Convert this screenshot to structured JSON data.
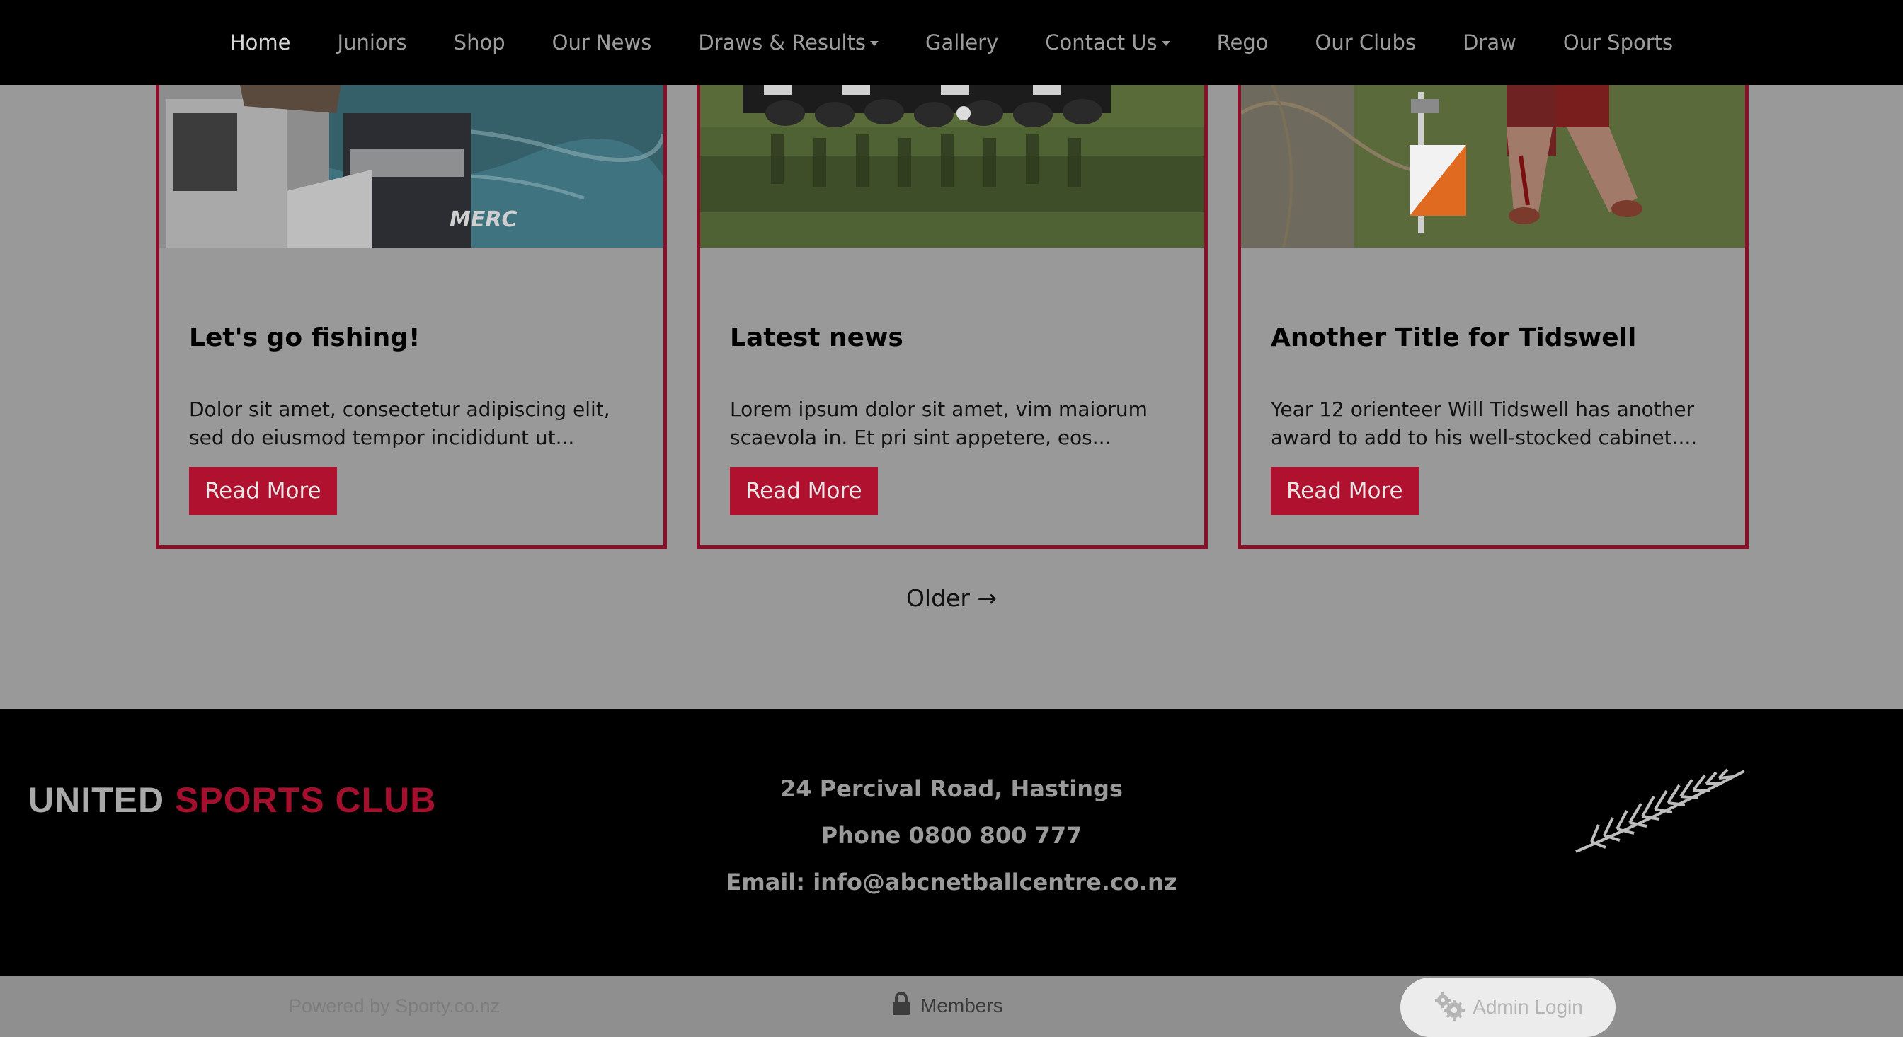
{
  "nav": {
    "items": [
      {
        "label": "Home"
      },
      {
        "label": "Juniors"
      },
      {
        "label": "Shop"
      },
      {
        "label": "Our News"
      },
      {
        "label": "Draws & Results"
      },
      {
        "label": "Gallery"
      },
      {
        "label": "Contact Us"
      },
      {
        "label": "Rego"
      },
      {
        "label": "Our Clubs"
      },
      {
        "label": "Draw"
      },
      {
        "label": "Our Sports"
      }
    ]
  },
  "posts": [
    {
      "title": "Let's go fishing!",
      "excerpt": "Dolor sit amet, consectetur adipiscing elit, sed do eiusmod tempor incididunt ut...",
      "button": "Read More"
    },
    {
      "title": "Latest news",
      "excerpt": "Lorem ipsum dolor sit amet, vim maiorum scaevola in. Et pri sint appetere, eos...",
      "button": "Read More"
    },
    {
      "title": "Another Title for Tidswell",
      "excerpt": "Year 12 orienteer Will Tidswell has another award to add to his well-stocked cabinet....",
      "button": "Read More"
    }
  ],
  "pagination": {
    "older": "Older →"
  },
  "footer": {
    "brand_word1": "UNITED",
    "brand_word2": "SPORTS CLUB",
    "address": "24 Percival Road, Hastings",
    "phone": "Phone 0800 800 777",
    "email": "Email: info@abcnetballcentre.co.nz"
  },
  "bottombar": {
    "powered": "Powered by Sporty.co.nz",
    "members": "Members",
    "admin": "Admin Login"
  },
  "colors": {
    "accent": "#b0112f",
    "card_border": "#8c0f2a",
    "overlay_bg": "#999999",
    "nav_bg": "#000000"
  },
  "icons": [
    "chevron-down-icon",
    "lock-icon",
    "gear-icon",
    "silver-fern-icon"
  ]
}
